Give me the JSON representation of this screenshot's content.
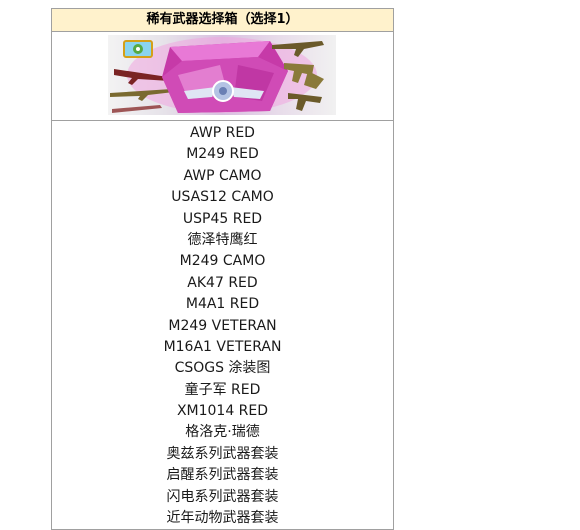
{
  "box": {
    "title": "稀有武器选择箱（选择1）",
    "items": [
      "AWP RED",
      "M249 RED",
      "AWP CAMO",
      "USAS12 CAMO",
      "USP45 RED",
      "德泽特鹰红",
      "M249 CAMO",
      "AK47 RED",
      "M4A1 RED",
      "M249 VETERAN",
      "M16A1 VETERAN",
      "CSOGS 涂装图",
      "童子军 RED",
      "XM1014 RED",
      "格洛克·瑞德",
      "奥兹系列武器套装",
      "启醒系列武器套装",
      "闪电系列武器套装",
      "近年动物武器套装"
    ]
  },
  "colors": {
    "header_bg": "#fff2cc",
    "border": "#a0a0a0",
    "box_pink": "#e040c0",
    "box_wing": "#c9d3e8"
  }
}
